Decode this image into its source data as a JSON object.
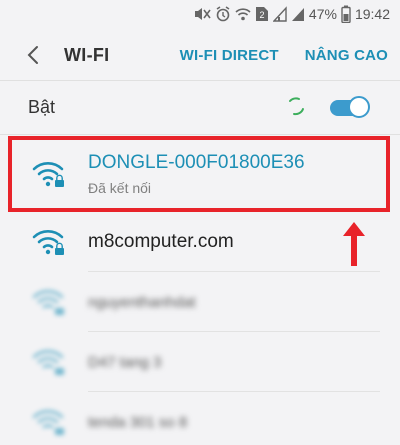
{
  "status_bar": {
    "battery_percent": "47%",
    "time": "19:42",
    "sim_badge": "2",
    "icons": [
      "mute-icon",
      "alarm-icon",
      "wifi-signal-icon",
      "sim-icon",
      "signal-icon",
      "signal-icon",
      "battery-icon"
    ]
  },
  "header": {
    "back_icon": "chevron-left-icon",
    "title": "WI-FI",
    "actions": [
      {
        "label": "WI-FI DIRECT"
      },
      {
        "label": "NÂNG CAO"
      }
    ]
  },
  "wifi_toggle": {
    "label": "Bật",
    "state": "on",
    "accent_color": "#3c9bcd"
  },
  "networks": [
    {
      "name": "DONGLE-000F01800E36",
      "status": "Đã kết nối",
      "connected": true,
      "secured": true,
      "icon": "wifi-lock-icon"
    },
    {
      "name": "m8computer.com",
      "status": "",
      "connected": false,
      "secured": true,
      "icon": "wifi-lock-icon"
    },
    {
      "name": "nguyenthanhdat",
      "status": "",
      "connected": false,
      "secured": true,
      "blurred": true,
      "icon": "wifi-lock-icon"
    },
    {
      "name": "D47 tang 3",
      "status": "",
      "connected": false,
      "secured": true,
      "blurred": true,
      "icon": "wifi-lock-icon"
    },
    {
      "name": "tenda 301 so 8",
      "status": "",
      "connected": false,
      "secured": true,
      "blurred": true,
      "icon": "wifi-lock-icon"
    }
  ],
  "colors": {
    "accent": "#1d8fb5",
    "highlight": "#e8232a",
    "background": "#f3f3f5"
  }
}
